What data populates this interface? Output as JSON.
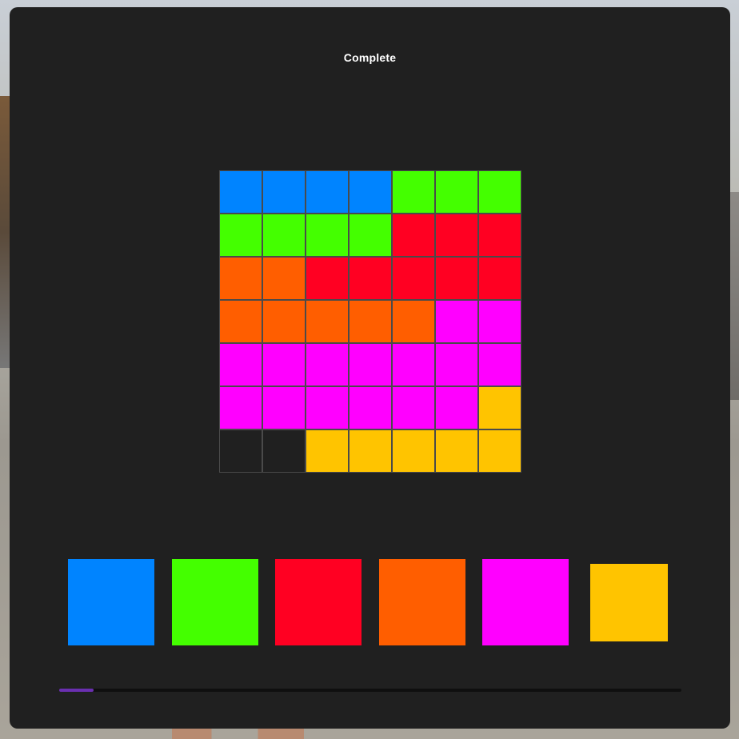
{
  "title": "Complete",
  "colors": {
    "blue": "#0084ff",
    "green": "#44ff00",
    "red": "#ff0022",
    "orange": "#ff5e00",
    "magenta": "#ff00ff",
    "yellow": "#ffc400",
    "empty": "#202020",
    "panel": "#202020",
    "progress": "#6a2fb0"
  },
  "grid": [
    [
      "blue",
      "blue",
      "blue",
      "blue",
      "green",
      "green",
      "green"
    ],
    [
      "green",
      "green",
      "green",
      "green",
      "red",
      "red",
      "red"
    ],
    [
      "orange",
      "orange",
      "red",
      "red",
      "red",
      "red",
      "red"
    ],
    [
      "orange",
      "orange",
      "orange",
      "orange",
      "orange",
      "magenta",
      "magenta"
    ],
    [
      "magenta",
      "magenta",
      "magenta",
      "magenta",
      "magenta",
      "magenta",
      "magenta"
    ],
    [
      "magenta",
      "magenta",
      "magenta",
      "magenta",
      "magenta",
      "magenta",
      "yellow"
    ],
    [
      "empty",
      "empty",
      "yellow",
      "yellow",
      "yellow",
      "yellow",
      "yellow"
    ]
  ],
  "palette": [
    {
      "color": "blue",
      "selected": false
    },
    {
      "color": "green",
      "selected": false
    },
    {
      "color": "red",
      "selected": false
    },
    {
      "color": "orange",
      "selected": false
    },
    {
      "color": "magenta",
      "selected": false
    },
    {
      "color": "yellow",
      "selected": true
    }
  ],
  "progress": 0.055
}
